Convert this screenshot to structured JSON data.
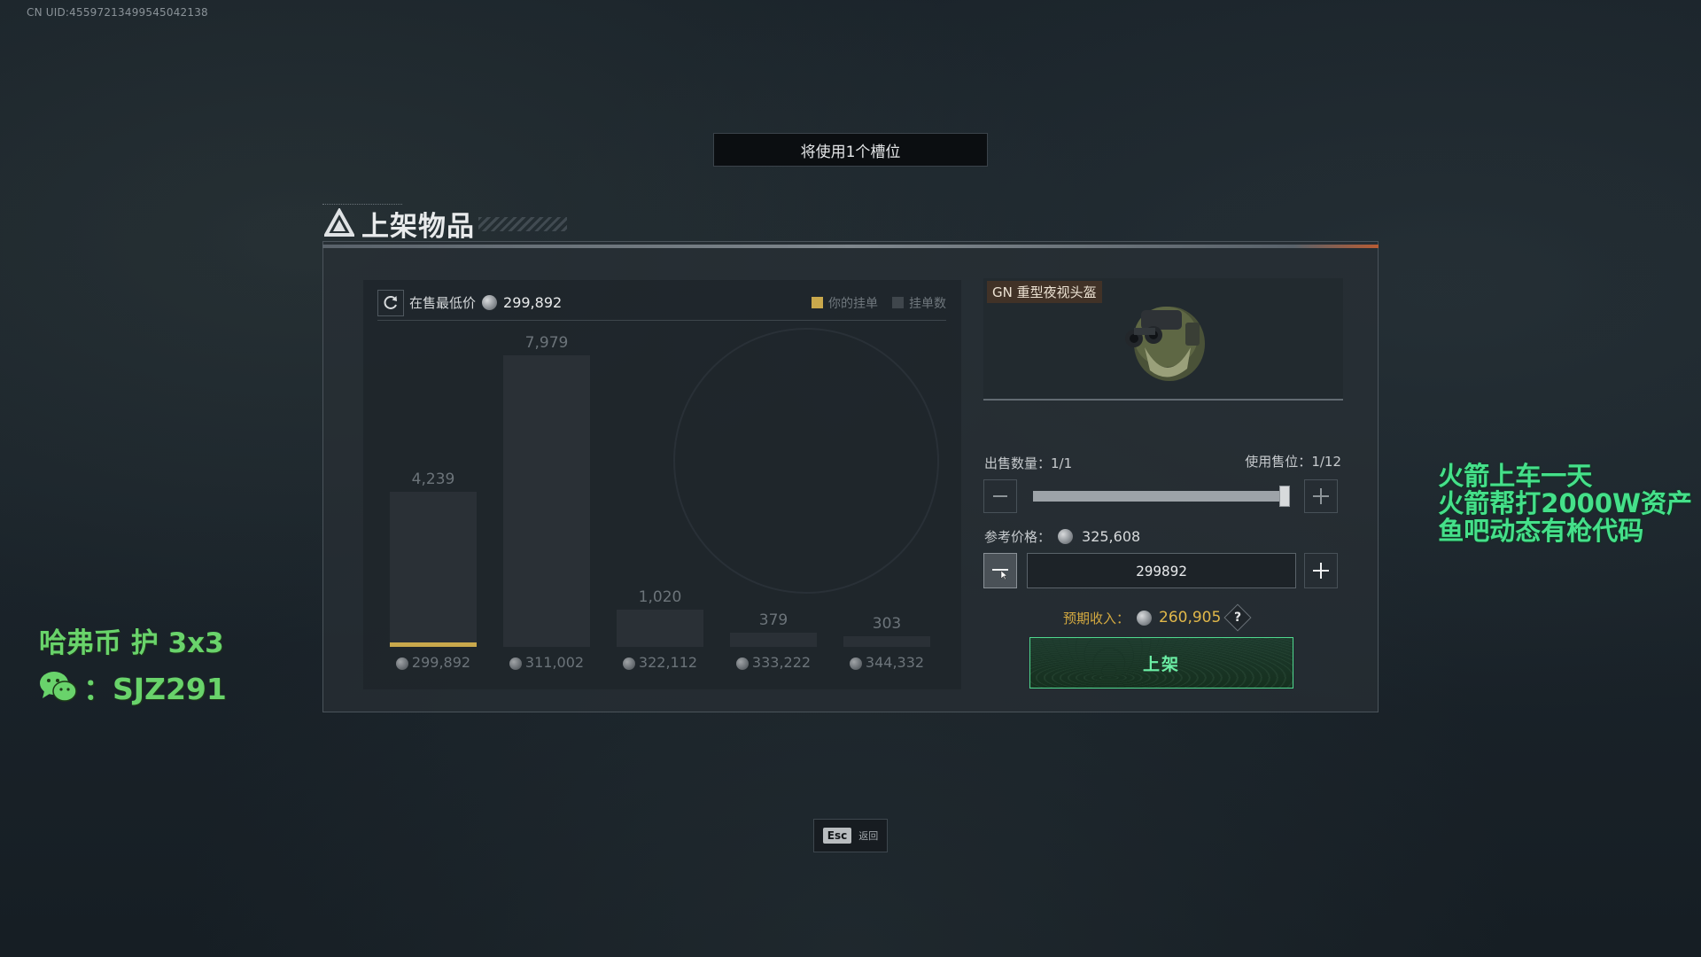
{
  "watermark_uid": "CN UID:4559721349954504213​8",
  "slot_banner": "将使用1个槽位",
  "panel": {
    "title": "上架物品"
  },
  "chart": {
    "lowest_label": "在售最低价",
    "lowest_value": "299,892",
    "legend_mine": "你的挂单",
    "legend_count": "挂单数",
    "mine_color": "#c9a84c"
  },
  "chart_data": {
    "type": "bar",
    "categories": [
      "299,892",
      "311,002",
      "322,112",
      "333,222",
      "344,332"
    ],
    "values": [
      4239,
      7979,
      1020,
      379,
      303
    ],
    "value_labels": [
      "4,239",
      "7,979",
      "1,020",
      "379",
      "303"
    ],
    "ylim": [
      0,
      8000
    ],
    "highlight_index": 0
  },
  "item": {
    "name": "GN 重型夜视头盔",
    "icon": "night-vision-helmet"
  },
  "quantity": {
    "label": "出售数量：",
    "value": "1/1"
  },
  "slots": {
    "label": "使用售位：",
    "value": "1/12"
  },
  "slider": {
    "level": 1.0
  },
  "reference": {
    "label": "参考价格：",
    "value": "325,608"
  },
  "price_input": {
    "value": "299892"
  },
  "income": {
    "label": "预期收入：",
    "value": "260,905",
    "help": "?"
  },
  "list_button": {
    "label": "上架"
  },
  "esc": {
    "key": "Esc",
    "label": "返回"
  },
  "overlay_right": [
    "火箭上车一天",
    "火箭帮打2000W资产",
    "鱼吧动态有枪代码"
  ],
  "overlay_left": {
    "line1": "哈弗币 护 3x3",
    "line2": "：SJZ291"
  }
}
